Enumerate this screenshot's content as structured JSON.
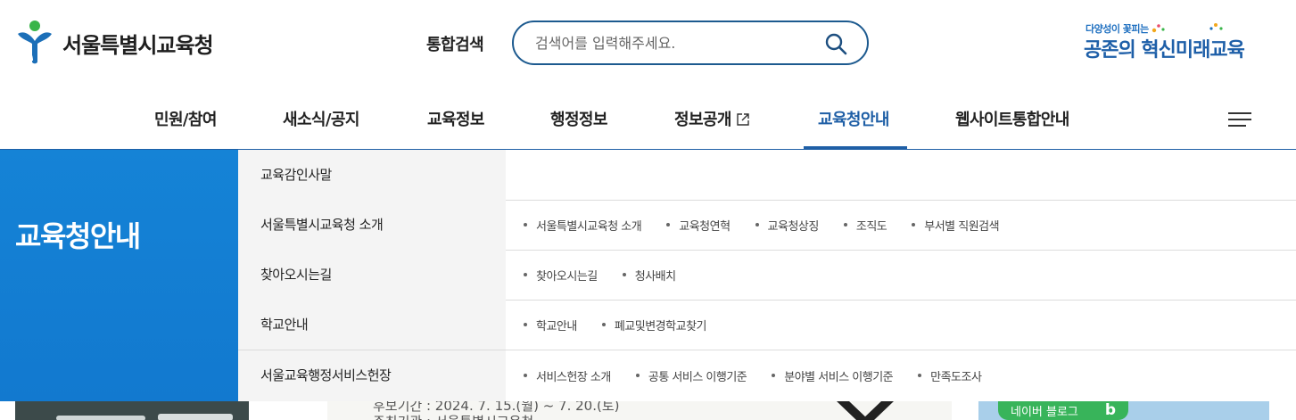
{
  "header": {
    "logo_text": "서울특별시교육청",
    "search_label": "통합검색",
    "search_placeholder": "검색어를 입력해주세요.",
    "slogan_small": "다양성이 꽃피는",
    "slogan_big": "공존의 혁신미래교육"
  },
  "nav": {
    "items": [
      {
        "label": "민원/참여"
      },
      {
        "label": "새소식/공지"
      },
      {
        "label": "교육정보"
      },
      {
        "label": "행정정보"
      },
      {
        "label": "정보공개"
      },
      {
        "label": "교육청안내",
        "active": true
      },
      {
        "label": "웹사이트통합안내"
      }
    ]
  },
  "mega_menu": {
    "title": "교육청안내",
    "rows": [
      {
        "label": "교육감인사말",
        "subs": []
      },
      {
        "label": "서울특별시교육청 소개",
        "subs": [
          "서울특별시교육청 소개",
          "교육청연혁",
          "교육청상징",
          "조직도",
          "부서별 직원검색"
        ]
      },
      {
        "label": "찾아오시는길",
        "subs": [
          "찾아오시는길",
          "청사배치"
        ]
      },
      {
        "label": "학교안내",
        "subs": [
          "학교안내",
          "폐교및변경학교찾기"
        ]
      },
      {
        "label": "서울교육행정서비스헌장",
        "subs": [
          "서비스헌장 소개",
          "공통 서비스 이행기준",
          "분야별 서비스 이행기준",
          "만족도조사"
        ]
      }
    ]
  },
  "background_peek": {
    "line1": "후보기간 : 2024. 7. 15.(월) ~ 7. 20.(토)",
    "line2": "주최기관 : 서울특별시교육청",
    "pill_label": "네이버 블로그",
    "pill_icon": "b"
  },
  "colors": {
    "brand_blue": "#1f5fa6",
    "side_blue": "#1583d6",
    "search_border": "#1d5a8f"
  }
}
